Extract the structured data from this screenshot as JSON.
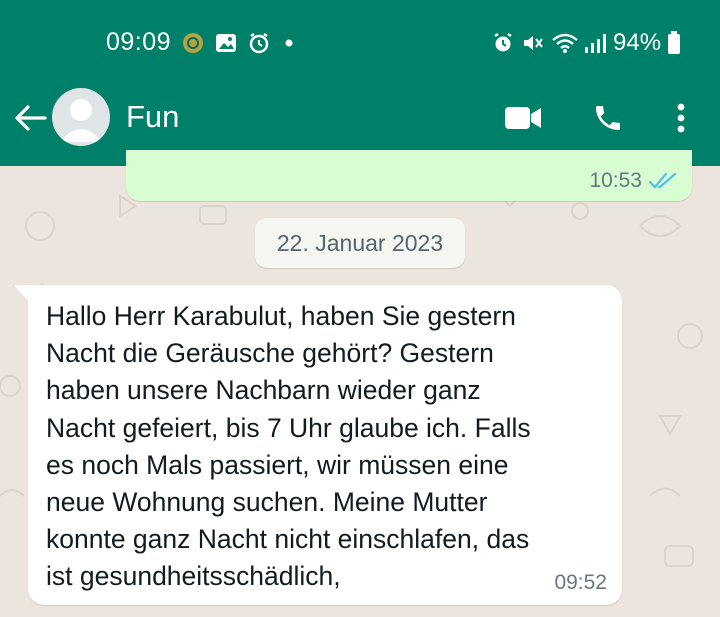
{
  "status_bar": {
    "time": "09:09",
    "battery_percent": "94%"
  },
  "header": {
    "contact_name": "Fun",
    "icons": [
      "back-arrow-icon",
      "avatar-placeholder",
      "video-call-icon",
      "voice-call-icon",
      "more-options-icon"
    ]
  },
  "messages": {
    "outgoing_last": {
      "time": "10:53",
      "status": "read"
    },
    "date_separator": "22. Januar 2023",
    "incoming": {
      "text": "Hallo Herr Karabulut, haben Sie gestern\nNacht die Geräusche gehört?  Gestern\nhaben unsere Nachbarn wieder ganz\nNacht gefeiert, bis 7 Uhr glaube ich. Falls\nes noch Mals passiert, wir müssen eine\nneue Wohnung suchen. Meine Mutter\nkonnte ganz Nacht nicht einschlafen, das\nist gesundheitsschädlich,",
      "time": "09:52"
    }
  },
  "colors": {
    "header": "#008069",
    "chat_background": "#ece5dd",
    "outgoing_bubble": "#d9fdd3",
    "incoming_bubble": "#ffffff",
    "read_ticks": "#53bdeb"
  }
}
